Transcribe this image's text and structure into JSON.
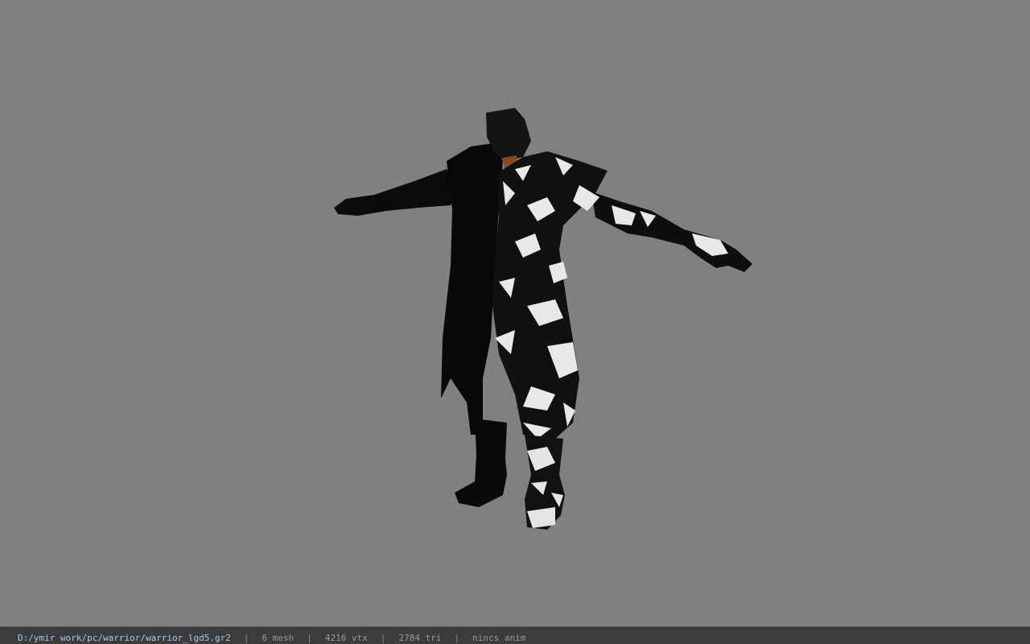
{
  "viewport": {
    "background": "#808080",
    "model_name": "warrior_lgd5"
  },
  "status": {
    "file_path": "D:/ymir work/pc/warrior/warrior_lgd5.gr2",
    "separator": "|",
    "mesh": "6 mesh",
    "vertices": "4216 vtx",
    "triangles": "2784 tri",
    "animation": "nincs anim"
  },
  "colors": {
    "status_bg": "#3c3c3c",
    "path_text": "#a8c8f0",
    "info_text": "#9a9a9a"
  }
}
